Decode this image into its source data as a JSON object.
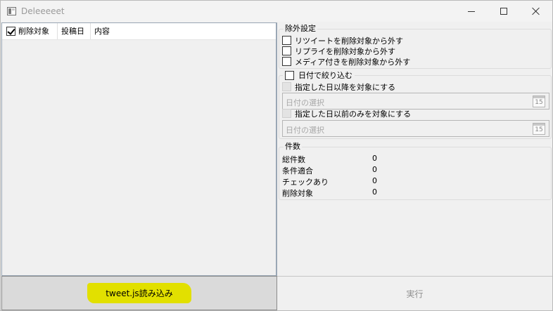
{
  "window": {
    "title": "Deleeeeet"
  },
  "list": {
    "columns": [
      {
        "label": "削除対象",
        "checked": true
      },
      {
        "label": "投稿日"
      },
      {
        "label": "内容"
      }
    ]
  },
  "exclude": {
    "title": "除外設定",
    "options": [
      {
        "label": "リツイートを削除対象から外す",
        "checked": false
      },
      {
        "label": "リプライを削除対象から外す",
        "checked": false
      },
      {
        "label": "メディア付きを削除対象から外す",
        "checked": false
      }
    ]
  },
  "date_filter": {
    "title": "日付で絞り込む",
    "checked": false,
    "after_label": "指定した日以降を対象にする",
    "after_placeholder": "日付の選択",
    "before_label": "指定した日以前のみを対象にする",
    "before_placeholder": "日付の選択",
    "calendar_day": "15"
  },
  "counts": {
    "title": "件数",
    "rows": [
      {
        "label": "総件数",
        "value": "0"
      },
      {
        "label": "条件適合",
        "value": "0"
      },
      {
        "label": "チェックあり",
        "value": "0"
      },
      {
        "label": "削除対象",
        "value": "0"
      }
    ]
  },
  "buttons": {
    "load": "tweet.js読み込み",
    "execute": "実行"
  },
  "colors": {
    "highlight": "#e2e000",
    "accent_border": "#9aa7b5"
  }
}
